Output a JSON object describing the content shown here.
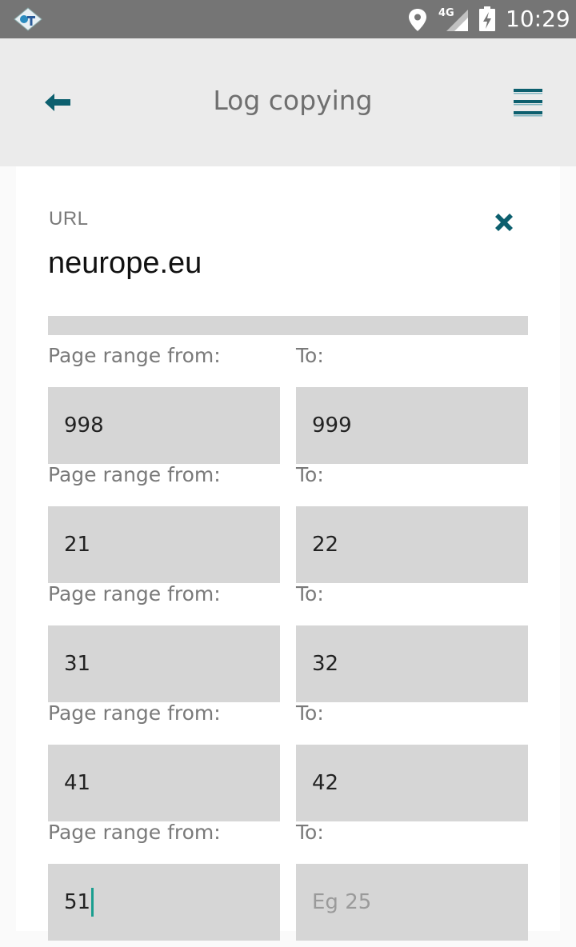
{
  "status_bar": {
    "time": "10:29",
    "network": "4G",
    "icons": [
      "app-icon",
      "location-icon",
      "signal-icon",
      "battery-charging-icon"
    ]
  },
  "app_bar": {
    "title": "Log copying",
    "icons": [
      "back-arrow-icon",
      "hamburger-menu-icon"
    ],
    "accent_color": "#0c5f6e"
  },
  "card": {
    "url_label": "URL",
    "url_value": "neurope.eu",
    "close_icon": "close-icon"
  },
  "ranges": [
    {
      "from_label": "Page range from:",
      "to_label": "To:",
      "from_value": "998",
      "to_value": "999",
      "to_placeholder": ""
    },
    {
      "from_label": "Page range from:",
      "to_label": "To:",
      "from_value": "21",
      "to_value": "22",
      "to_placeholder": ""
    },
    {
      "from_label": "Page range from:",
      "to_label": "To:",
      "from_value": "31",
      "to_value": "32",
      "to_placeholder": ""
    },
    {
      "from_label": "Page range from:",
      "to_label": "To:",
      "from_value": "41",
      "to_value": "42",
      "to_placeholder": ""
    },
    {
      "from_label": "Page range from:",
      "to_label": "To:",
      "from_value": "51",
      "to_value": "",
      "to_placeholder": "Eg 25"
    }
  ]
}
